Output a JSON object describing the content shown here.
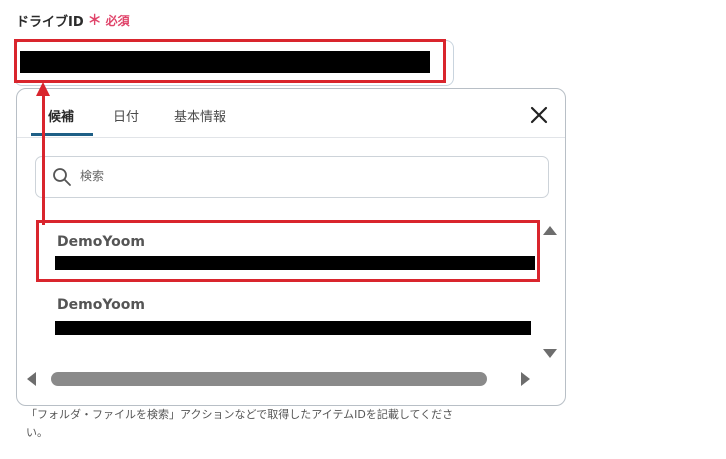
{
  "field": {
    "label": "ドライブID",
    "required_mark": "＊",
    "required_text": "必須"
  },
  "popup": {
    "tabs": [
      {
        "label": "候補",
        "active": true
      },
      {
        "label": "日付",
        "active": false
      },
      {
        "label": "基本情報",
        "active": false
      }
    ],
    "close_icon": "close-icon",
    "search": {
      "placeholder": "検索",
      "value": ""
    },
    "items": [
      {
        "name": "DemoYoom"
      },
      {
        "name": "DemoYoom"
      }
    ]
  },
  "help_text": "「フォルダ・ファイルを検索」アクションなどで取得したアイテムIDを記載してください。",
  "colors": {
    "required": "#e0446a",
    "highlight": "#d9252d",
    "tab_underline": "#1e5f86"
  }
}
